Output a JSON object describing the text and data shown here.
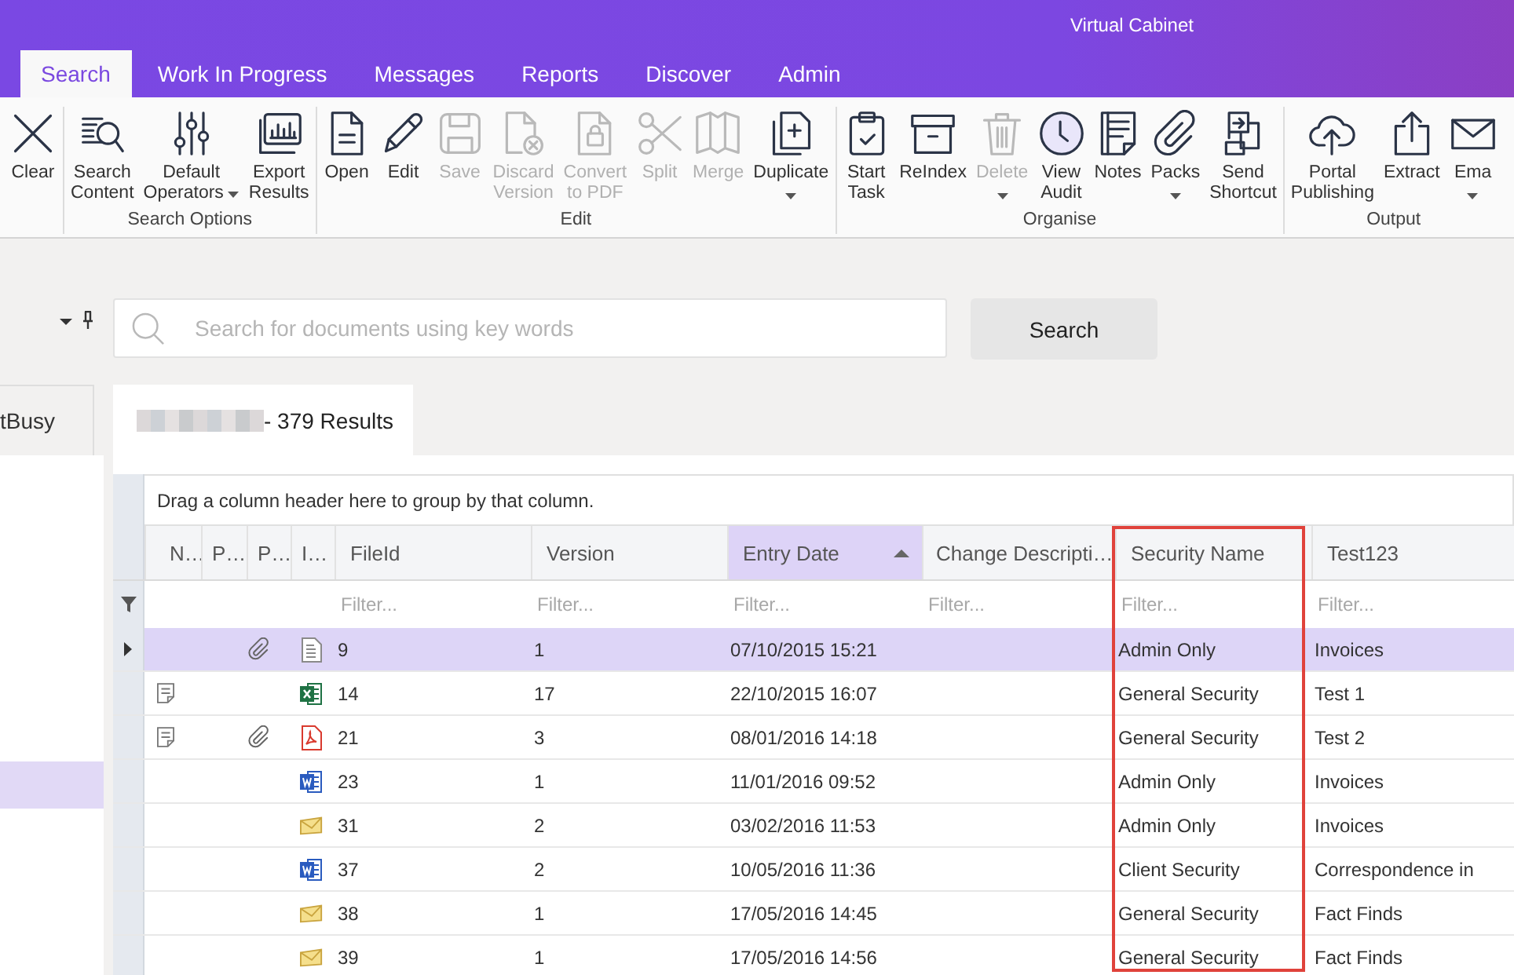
{
  "window": {
    "title": "Virtual Cabinet"
  },
  "tabs": [
    {
      "label": "Search",
      "selected": true
    },
    {
      "label": "Work In Progress",
      "selected": false
    },
    {
      "label": "Messages",
      "selected": false
    },
    {
      "label": "Reports",
      "selected": false
    },
    {
      "label": "Discover",
      "selected": false
    },
    {
      "label": "Admin",
      "selected": false
    }
  ],
  "ribbon": {
    "groups": [
      {
        "buttons": [
          {
            "lines": [
              "Clear"
            ],
            "disabled": false,
            "dropdown": false
          }
        ]
      },
      {
        "label": "Search Options",
        "buttons": [
          {
            "lines": [
              "Search",
              "Content"
            ],
            "disabled": false,
            "dropdown": false
          },
          {
            "lines": [
              "Default",
              "Operators"
            ],
            "disabled": false,
            "dropdown": true
          },
          {
            "lines": [
              "Export",
              "Results"
            ],
            "disabled": false,
            "dropdown": false
          }
        ]
      },
      {
        "label": "Edit",
        "buttons": [
          {
            "lines": [
              "Open"
            ],
            "disabled": false,
            "dropdown": false
          },
          {
            "lines": [
              "Edit"
            ],
            "disabled": false,
            "dropdown": false
          },
          {
            "lines": [
              "Save"
            ],
            "disabled": true,
            "dropdown": false
          },
          {
            "lines": [
              "Discard",
              "Version"
            ],
            "disabled": true,
            "dropdown": false
          },
          {
            "lines": [
              "Convert",
              "to PDF"
            ],
            "disabled": true,
            "dropdown": false
          },
          {
            "lines": [
              "Split"
            ],
            "disabled": true,
            "dropdown": false
          },
          {
            "lines": [
              "Merge"
            ],
            "disabled": true,
            "dropdown": false
          },
          {
            "lines": [
              "Duplicate"
            ],
            "disabled": false,
            "dropdown": true
          }
        ]
      },
      {
        "label": "Organise",
        "buttons": [
          {
            "lines": [
              "Start",
              "Task"
            ],
            "disabled": false,
            "dropdown": false
          },
          {
            "lines": [
              "ReIndex"
            ],
            "disabled": false,
            "dropdown": false
          },
          {
            "lines": [
              "Delete"
            ],
            "disabled": true,
            "dropdown": true
          },
          {
            "lines": [
              "View",
              "Audit"
            ],
            "disabled": false,
            "dropdown": false
          },
          {
            "lines": [
              "Notes"
            ],
            "disabled": false,
            "dropdown": false
          },
          {
            "lines": [
              "Packs"
            ],
            "disabled": false,
            "dropdown": true
          },
          {
            "lines": [
              "Send",
              "Shortcut"
            ],
            "disabled": false,
            "dropdown": false
          }
        ]
      },
      {
        "label": "Output",
        "buttons": [
          {
            "lines": [
              "Portal",
              "Publishing"
            ],
            "disabled": false,
            "dropdown": false
          },
          {
            "lines": [
              "Extract"
            ],
            "disabled": false,
            "dropdown": false
          },
          {
            "lines": [
              "Ema"
            ],
            "disabled": false,
            "dropdown": true
          }
        ]
      }
    ]
  },
  "side_panel": {
    "tab": "tBusy",
    "rows": [
      {
        "selected": true
      }
    ]
  },
  "search": {
    "placeholder": "Search for documents using key words",
    "button": "Search"
  },
  "results_tab": {
    "label": "- 379 Results",
    "selected": true
  },
  "grid": {
    "group_hint": "Drag a column header here to group by that column.",
    "columns": [
      {
        "label": "N…",
        "sorted": false,
        "highlighted": false
      },
      {
        "label": "P…",
        "sorted": false,
        "highlighted": false
      },
      {
        "label": "P…",
        "sorted": false,
        "highlighted": false
      },
      {
        "label": "I…",
        "sorted": false,
        "highlighted": false
      },
      {
        "label": "FileId",
        "filter_placeholder": "Filter...",
        "sorted": false,
        "highlighted": false
      },
      {
        "label": "Version",
        "filter_placeholder": "Filter...",
        "sorted": false,
        "highlighted": false
      },
      {
        "label": "Entry Date",
        "filter_placeholder": "Filter...",
        "sorted": true,
        "highlighted": false
      },
      {
        "label": "Change Descripti…",
        "filter_placeholder": "Filter...",
        "sorted": false,
        "highlighted": false
      },
      {
        "label": "Security Name",
        "filter_placeholder": "Filter...",
        "sorted": false,
        "highlighted": true
      },
      {
        "label": "Test123",
        "filter_placeholder": "Filter...",
        "sorted": false,
        "highlighted": false
      }
    ],
    "rows": [
      {
        "selected": true,
        "notes": false,
        "attachment": true,
        "kind": "text",
        "cells": [
          "",
          "",
          "",
          "",
          "9",
          "1",
          "07/10/2015 15:21",
          "",
          "Admin Only",
          "Invoices"
        ]
      },
      {
        "selected": false,
        "notes": true,
        "attachment": false,
        "kind": "spreadsheet",
        "cells": [
          "",
          "",
          "",
          "",
          "14",
          "17",
          "22/10/2015 16:07",
          "",
          "General Security",
          "Test 1"
        ]
      },
      {
        "selected": false,
        "notes": true,
        "attachment": true,
        "kind": "pdf",
        "cells": [
          "",
          "",
          "",
          "",
          "21",
          "3",
          "08/01/2016 14:18",
          "",
          "General Security",
          "Test 2"
        ]
      },
      {
        "selected": false,
        "notes": false,
        "attachment": false,
        "kind": "word",
        "cells": [
          "",
          "",
          "",
          "",
          "23",
          "1",
          "11/01/2016 09:52",
          "",
          "Admin Only",
          "Invoices"
        ]
      },
      {
        "selected": false,
        "notes": false,
        "attachment": false,
        "kind": "email",
        "cells": [
          "",
          "",
          "",
          "",
          "31",
          "2",
          "03/02/2016 11:53",
          "",
          "Admin Only",
          "Invoices"
        ]
      },
      {
        "selected": false,
        "notes": false,
        "attachment": false,
        "kind": "word",
        "cells": [
          "",
          "",
          "",
          "",
          "37",
          "2",
          "10/05/2016 11:36",
          "",
          "Client Security",
          "Correspondence in"
        ]
      },
      {
        "selected": false,
        "notes": false,
        "attachment": false,
        "kind": "email",
        "cells": [
          "",
          "",
          "",
          "",
          "38",
          "1",
          "17/05/2016 14:45",
          "",
          "General Security",
          "Fact Finds"
        ]
      },
      {
        "selected": false,
        "notes": false,
        "attachment": false,
        "kind": "email",
        "cells": [
          "",
          "",
          "",
          "",
          "39",
          "1",
          "17/05/2016 14:56",
          "",
          "General Security",
          "Fact Finds"
        ]
      }
    ]
  }
}
